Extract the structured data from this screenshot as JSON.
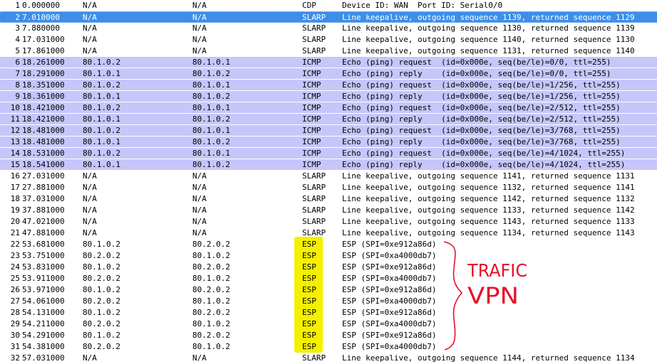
{
  "packets": [
    {
      "no": "1",
      "time": "0.000000",
      "src": "N/A",
      "dst": "N/A",
      "proto": "CDP",
      "info": "Device ID: WAN  Port ID: Serial0/0"
    },
    {
      "no": "2",
      "time": "7.010000",
      "src": "N/A",
      "dst": "N/A",
      "proto": "SLARP",
      "info": "Line keepalive, outgoing sequence 1139, returned sequence 1129"
    },
    {
      "no": "3",
      "time": "7.880000",
      "src": "N/A",
      "dst": "N/A",
      "proto": "SLARP",
      "info": "Line keepalive, outgoing sequence 1130, returned sequence 1139"
    },
    {
      "no": "4",
      "time": "17.031000",
      "src": "N/A",
      "dst": "N/A",
      "proto": "SLARP",
      "info": "Line keepalive, outgoing sequence 1140, returned sequence 1130"
    },
    {
      "no": "5",
      "time": "17.861000",
      "src": "N/A",
      "dst": "N/A",
      "proto": "SLARP",
      "info": "Line keepalive, outgoing sequence 1131, returned sequence 1140"
    },
    {
      "no": "6",
      "time": "18.261000",
      "src": "80.1.0.2",
      "dst": "80.1.0.1",
      "proto": "ICMP",
      "info": "Echo (ping) request  (id=0x000e, seq(be/le)=0/0, ttl=255)"
    },
    {
      "no": "7",
      "time": "18.291000",
      "src": "80.1.0.1",
      "dst": "80.1.0.2",
      "proto": "ICMP",
      "info": "Echo (ping) reply    (id=0x000e, seq(be/le)=0/0, ttl=255)"
    },
    {
      "no": "8",
      "time": "18.351000",
      "src": "80.1.0.2",
      "dst": "80.1.0.1",
      "proto": "ICMP",
      "info": "Echo (ping) request  (id=0x000e, seq(be/le)=1/256, ttl=255)"
    },
    {
      "no": "9",
      "time": "18.361000",
      "src": "80.1.0.1",
      "dst": "80.1.0.2",
      "proto": "ICMP",
      "info": "Echo (ping) reply    (id=0x000e, seq(be/le)=1/256, ttl=255)"
    },
    {
      "no": "10",
      "time": "18.421000",
      "src": "80.1.0.2",
      "dst": "80.1.0.1",
      "proto": "ICMP",
      "info": "Echo (ping) request  (id=0x000e, seq(be/le)=2/512, ttl=255)"
    },
    {
      "no": "11",
      "time": "18.421000",
      "src": "80.1.0.1",
      "dst": "80.1.0.2",
      "proto": "ICMP",
      "info": "Echo (ping) reply    (id=0x000e, seq(be/le)=2/512, ttl=255)"
    },
    {
      "no": "12",
      "time": "18.481000",
      "src": "80.1.0.2",
      "dst": "80.1.0.1",
      "proto": "ICMP",
      "info": "Echo (ping) request  (id=0x000e, seq(be/le)=3/768, ttl=255)"
    },
    {
      "no": "13",
      "time": "18.481000",
      "src": "80.1.0.1",
      "dst": "80.1.0.2",
      "proto": "ICMP",
      "info": "Echo (ping) reply    (id=0x000e, seq(be/le)=3/768, ttl=255)"
    },
    {
      "no": "14",
      "time": "18.531000",
      "src": "80.1.0.2",
      "dst": "80.1.0.1",
      "proto": "ICMP",
      "info": "Echo (ping) request  (id=0x000e, seq(be/le)=4/1024, ttl=255)"
    },
    {
      "no": "15",
      "time": "18.541000",
      "src": "80.1.0.1",
      "dst": "80.1.0.2",
      "proto": "ICMP",
      "info": "Echo (ping) reply    (id=0x000e, seq(be/le)=4/1024, ttl=255)"
    },
    {
      "no": "16",
      "time": "27.031000",
      "src": "N/A",
      "dst": "N/A",
      "proto": "SLARP",
      "info": "Line keepalive, outgoing sequence 1141, returned sequence 1131"
    },
    {
      "no": "17",
      "time": "27.881000",
      "src": "N/A",
      "dst": "N/A",
      "proto": "SLARP",
      "info": "Line keepalive, outgoing sequence 1132, returned sequence 1141"
    },
    {
      "no": "18",
      "time": "37.031000",
      "src": "N/A",
      "dst": "N/A",
      "proto": "SLARP",
      "info": "Line keepalive, outgoing sequence 1142, returned sequence 1132"
    },
    {
      "no": "19",
      "time": "37.881000",
      "src": "N/A",
      "dst": "N/A",
      "proto": "SLARP",
      "info": "Line keepalive, outgoing sequence 1133, returned sequence 1142"
    },
    {
      "no": "20",
      "time": "47.021000",
      "src": "N/A",
      "dst": "N/A",
      "proto": "SLARP",
      "info": "Line keepalive, outgoing sequence 1143, returned sequence 1133"
    },
    {
      "no": "21",
      "time": "47.881000",
      "src": "N/A",
      "dst": "N/A",
      "proto": "SLARP",
      "info": "Line keepalive, outgoing sequence 1134, returned sequence 1143"
    },
    {
      "no": "22",
      "time": "53.681000",
      "src": "80.1.0.2",
      "dst": "80.2.0.2",
      "proto": "ESP",
      "info": "ESP (SPI=0xe912a86d)"
    },
    {
      "no": "23",
      "time": "53.751000",
      "src": "80.2.0.2",
      "dst": "80.1.0.2",
      "proto": "ESP",
      "info": "ESP (SPI=0xa4000db7)"
    },
    {
      "no": "24",
      "time": "53.831000",
      "src": "80.1.0.2",
      "dst": "80.2.0.2",
      "proto": "ESP",
      "info": "ESP (SPI=0xe912a86d)"
    },
    {
      "no": "25",
      "time": "53.911000",
      "src": "80.2.0.2",
      "dst": "80.1.0.2",
      "proto": "ESP",
      "info": "ESP (SPI=0xa4000db7)"
    },
    {
      "no": "26",
      "time": "53.971000",
      "src": "80.1.0.2",
      "dst": "80.2.0.2",
      "proto": "ESP",
      "info": "ESP (SPI=0xe912a86d)"
    },
    {
      "no": "27",
      "time": "54.061000",
      "src": "80.2.0.2",
      "dst": "80.1.0.2",
      "proto": "ESP",
      "info": "ESP (SPI=0xa4000db7)"
    },
    {
      "no": "28",
      "time": "54.131000",
      "src": "80.1.0.2",
      "dst": "80.2.0.2",
      "proto": "ESP",
      "info": "ESP (SPI=0xe912a86d)"
    },
    {
      "no": "29",
      "time": "54.211000",
      "src": "80.2.0.2",
      "dst": "80.1.0.2",
      "proto": "ESP",
      "info": "ESP (SPI=0xa4000db7)"
    },
    {
      "no": "30",
      "time": "54.291000",
      "src": "80.1.0.2",
      "dst": "80.2.0.2",
      "proto": "ESP",
      "info": "ESP (SPI=0xe912a86d)"
    },
    {
      "no": "31",
      "time": "54.381000",
      "src": "80.2.0.2",
      "dst": "80.1.0.2",
      "proto": "ESP",
      "info": "ESP (SPI=0xa4000db7)"
    },
    {
      "no": "32",
      "time": "57.031000",
      "src": "N/A",
      "dst": "N/A",
      "proto": "SLARP",
      "info": "Line keepalive, outgoing sequence 1144, returned sequence 1134"
    }
  ],
  "selected_row": "2",
  "annotation": {
    "line1": "TRAFIC",
    "line2": "VPN",
    "color": "#e8102a"
  },
  "colors": {
    "selected": "#3d8ee8",
    "icmp": "#c6c6fa",
    "esp_highlight": "#f4f000"
  }
}
